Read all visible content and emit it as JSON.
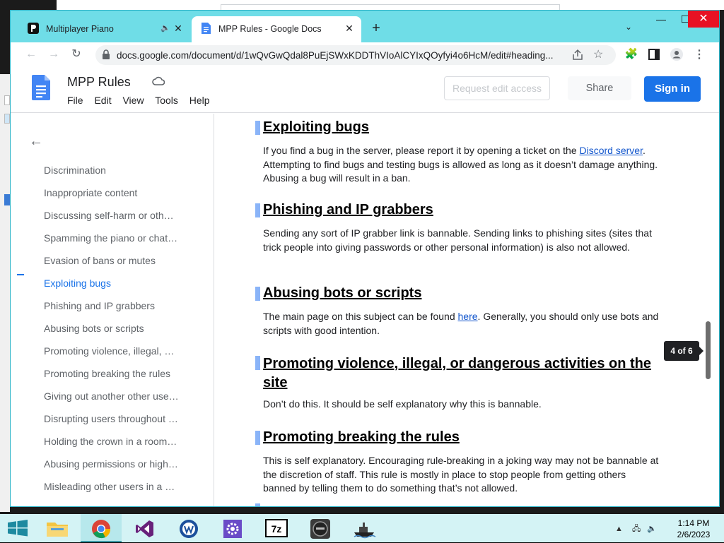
{
  "browser": {
    "tabs": [
      {
        "title": "Multiplayer Piano",
        "icon": "mpp-logo-icon",
        "audio": true
      },
      {
        "title": "MPP Rules - Google Docs",
        "icon": "google-docs-icon",
        "active": true
      }
    ],
    "url": "docs.google.com/document/d/1wQvGwQdal8PuEjSWxKDDThVIoAlCYIxQOyfyi4o6HcM/edit#heading..."
  },
  "docs": {
    "title": "MPP Rules",
    "menu": [
      "File",
      "Edit",
      "View",
      "Tools",
      "Help"
    ],
    "request_edit": "Request edit access",
    "share": "Share",
    "sign_in": "Sign in"
  },
  "outline": {
    "items": [
      "Discrimination",
      "Inappropriate content",
      "Discussing self-harm or oth…",
      "Spamming the piano or chat…",
      "Evasion of bans or mutes",
      "Exploiting bugs",
      "Phishing and IP grabbers",
      "Abusing bots or scripts",
      "Promoting violence, illegal, …",
      "Promoting breaking the rules",
      "Giving out another other use…",
      "Disrupting users throughout …",
      "Holding the crown in a room…",
      "Abusing permissions or high…",
      "Misleading other users in a …"
    ],
    "active_index": 5
  },
  "document": {
    "sections": [
      {
        "heading": "Exploiting bugs",
        "body_pre": "If you find a bug in the server, please report it by opening a ticket on the ",
        "link": "Discord server",
        "body_post": ". Attempting to find bugs and testing bugs is allowed as long as it doesn’t damage anything. Abusing a bug will result in a ban."
      },
      {
        "heading": "Phishing and IP grabbers",
        "body": "Sending any sort of IP grabber link is bannable. Sending links to phishing sites (sites that trick people into giving passwords or other personal information) is also not allowed."
      },
      {
        "heading": "Abusing bots or scripts",
        "body_pre": "The main page on this subject can be found ",
        "link": "here",
        "body_post": ". Generally, you should only use bots and scripts with good intention."
      },
      {
        "heading": "Promoting violence, illegal, or dangerous activities on the site",
        "body": "Don’t do this. It should be self explanatory why this is bannable."
      },
      {
        "heading": "Promoting breaking the rules",
        "body": "This is self explanatory. Encouraging rule-breaking in a joking way may not be bannable at the discretion of staff. This rule is mostly in place to stop people from getting others banned by telling them to do something that’s not allowed."
      }
    ],
    "page_indicator": "4 of 6"
  },
  "taskbar": {
    "apps": [
      "file-explorer-icon",
      "chrome-icon",
      "visual-studio-icon",
      "wireguard-icon",
      "settings-gear-icon",
      "7zip-icon",
      "disc-app-icon",
      "ship-app-icon"
    ],
    "time": "1:14 PM",
    "date": "2/6/2023"
  },
  "colors": {
    "accent": "#1a73e8",
    "tabstrip": "#6fdde7",
    "taskbar": "#d4f3f5",
    "link": "#1155cc"
  }
}
